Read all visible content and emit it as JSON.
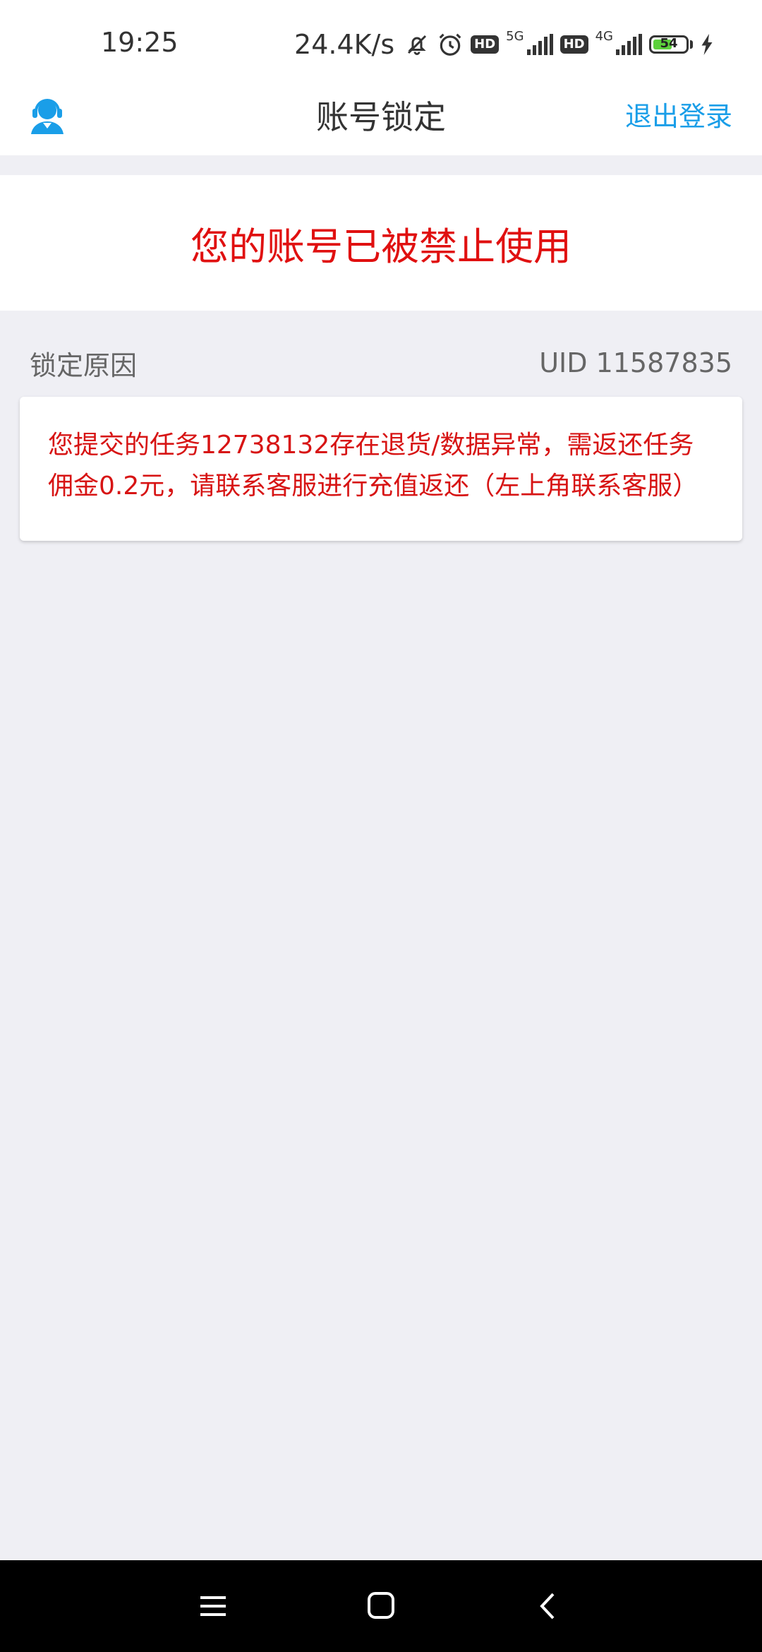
{
  "status_bar": {
    "time": "19:25",
    "net_speed": "24.4K/s",
    "hd1": "HD",
    "gen1": "5G",
    "hd2": "HD",
    "gen2": "4G",
    "battery_level": "54",
    "icons": [
      "mute-bell-icon",
      "alarm-icon",
      "signal-icon",
      "battery-icon",
      "charging-icon"
    ]
  },
  "header": {
    "title": "账号锁定",
    "logout_label": "退出登录",
    "left_icon": "customer-service-icon"
  },
  "alert": {
    "text": "您的账号已被禁止使用"
  },
  "lock_section": {
    "label": "锁定原因",
    "uid": "UID 11587835"
  },
  "reason": {
    "text": "您提交的任务12738132存在退货/数据异常，需返还任务佣金0.2元，请联系客服进行充值返还（左上角联系客服）"
  },
  "colors": {
    "accent": "#1a9ee8",
    "alert_red": "#e01010",
    "background": "#efeff4"
  },
  "nav": {
    "icons": [
      "menu-icon",
      "home-icon",
      "back-icon"
    ]
  }
}
